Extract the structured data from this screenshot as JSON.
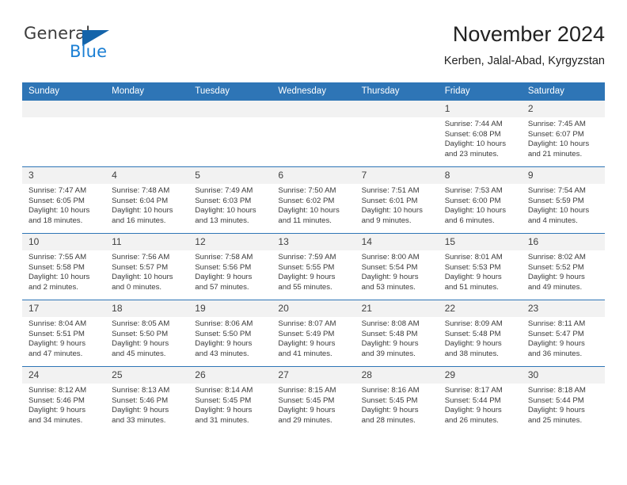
{
  "brand": {
    "word_one": "General",
    "word_two": "Blue",
    "triangle_color": "#1464aa",
    "blue_color": "#1b7fd4",
    "gray_color": "#3c3c3c"
  },
  "header": {
    "title": "November 2024",
    "subtitle": "Kerben, Jalal-Abad, Kyrgyzstan"
  },
  "theme": {
    "header_blue": "#2e75b6",
    "daynum_band": "#f2f2f2",
    "text": "#3a3a3a"
  },
  "weekday_headers": [
    "Sunday",
    "Monday",
    "Tuesday",
    "Wednesday",
    "Thursday",
    "Friday",
    "Saturday"
  ],
  "labels": {
    "sunrise_prefix": "Sunrise:",
    "sunset_prefix": "Sunset:",
    "daylight_prefix": "Daylight:"
  },
  "weeks": [
    [
      {
        "day": "",
        "sunrise": "",
        "sunset": "",
        "daylight_line1": "",
        "daylight_line2": ""
      },
      {
        "day": "",
        "sunrise": "",
        "sunset": "",
        "daylight_line1": "",
        "daylight_line2": ""
      },
      {
        "day": "",
        "sunrise": "",
        "sunset": "",
        "daylight_line1": "",
        "daylight_line2": ""
      },
      {
        "day": "",
        "sunrise": "",
        "sunset": "",
        "daylight_line1": "",
        "daylight_line2": ""
      },
      {
        "day": "",
        "sunrise": "",
        "sunset": "",
        "daylight_line1": "",
        "daylight_line2": ""
      },
      {
        "day": "1",
        "sunrise": "Sunrise: 7:44 AM",
        "sunset": "Sunset: 6:08 PM",
        "daylight_line1": "Daylight: 10 hours",
        "daylight_line2": "and 23 minutes."
      },
      {
        "day": "2",
        "sunrise": "Sunrise: 7:45 AM",
        "sunset": "Sunset: 6:07 PM",
        "daylight_line1": "Daylight: 10 hours",
        "daylight_line2": "and 21 minutes."
      }
    ],
    [
      {
        "day": "3",
        "sunrise": "Sunrise: 7:47 AM",
        "sunset": "Sunset: 6:05 PM",
        "daylight_line1": "Daylight: 10 hours",
        "daylight_line2": "and 18 minutes."
      },
      {
        "day": "4",
        "sunrise": "Sunrise: 7:48 AM",
        "sunset": "Sunset: 6:04 PM",
        "daylight_line1": "Daylight: 10 hours",
        "daylight_line2": "and 16 minutes."
      },
      {
        "day": "5",
        "sunrise": "Sunrise: 7:49 AM",
        "sunset": "Sunset: 6:03 PM",
        "daylight_line1": "Daylight: 10 hours",
        "daylight_line2": "and 13 minutes."
      },
      {
        "day": "6",
        "sunrise": "Sunrise: 7:50 AM",
        "sunset": "Sunset: 6:02 PM",
        "daylight_line1": "Daylight: 10 hours",
        "daylight_line2": "and 11 minutes."
      },
      {
        "day": "7",
        "sunrise": "Sunrise: 7:51 AM",
        "sunset": "Sunset: 6:01 PM",
        "daylight_line1": "Daylight: 10 hours",
        "daylight_line2": "and 9 minutes."
      },
      {
        "day": "8",
        "sunrise": "Sunrise: 7:53 AM",
        "sunset": "Sunset: 6:00 PM",
        "daylight_line1": "Daylight: 10 hours",
        "daylight_line2": "and 6 minutes."
      },
      {
        "day": "9",
        "sunrise": "Sunrise: 7:54 AM",
        "sunset": "Sunset: 5:59 PM",
        "daylight_line1": "Daylight: 10 hours",
        "daylight_line2": "and 4 minutes."
      }
    ],
    [
      {
        "day": "10",
        "sunrise": "Sunrise: 7:55 AM",
        "sunset": "Sunset: 5:58 PM",
        "daylight_line1": "Daylight: 10 hours",
        "daylight_line2": "and 2 minutes."
      },
      {
        "day": "11",
        "sunrise": "Sunrise: 7:56 AM",
        "sunset": "Sunset: 5:57 PM",
        "daylight_line1": "Daylight: 10 hours",
        "daylight_line2": "and 0 minutes."
      },
      {
        "day": "12",
        "sunrise": "Sunrise: 7:58 AM",
        "sunset": "Sunset: 5:56 PM",
        "daylight_line1": "Daylight: 9 hours",
        "daylight_line2": "and 57 minutes."
      },
      {
        "day": "13",
        "sunrise": "Sunrise: 7:59 AM",
        "sunset": "Sunset: 5:55 PM",
        "daylight_line1": "Daylight: 9 hours",
        "daylight_line2": "and 55 minutes."
      },
      {
        "day": "14",
        "sunrise": "Sunrise: 8:00 AM",
        "sunset": "Sunset: 5:54 PM",
        "daylight_line1": "Daylight: 9 hours",
        "daylight_line2": "and 53 minutes."
      },
      {
        "day": "15",
        "sunrise": "Sunrise: 8:01 AM",
        "sunset": "Sunset: 5:53 PM",
        "daylight_line1": "Daylight: 9 hours",
        "daylight_line2": "and 51 minutes."
      },
      {
        "day": "16",
        "sunrise": "Sunrise: 8:02 AM",
        "sunset": "Sunset: 5:52 PM",
        "daylight_line1": "Daylight: 9 hours",
        "daylight_line2": "and 49 minutes."
      }
    ],
    [
      {
        "day": "17",
        "sunrise": "Sunrise: 8:04 AM",
        "sunset": "Sunset: 5:51 PM",
        "daylight_line1": "Daylight: 9 hours",
        "daylight_line2": "and 47 minutes."
      },
      {
        "day": "18",
        "sunrise": "Sunrise: 8:05 AM",
        "sunset": "Sunset: 5:50 PM",
        "daylight_line1": "Daylight: 9 hours",
        "daylight_line2": "and 45 minutes."
      },
      {
        "day": "19",
        "sunrise": "Sunrise: 8:06 AM",
        "sunset": "Sunset: 5:50 PM",
        "daylight_line1": "Daylight: 9 hours",
        "daylight_line2": "and 43 minutes."
      },
      {
        "day": "20",
        "sunrise": "Sunrise: 8:07 AM",
        "sunset": "Sunset: 5:49 PM",
        "daylight_line1": "Daylight: 9 hours",
        "daylight_line2": "and 41 minutes."
      },
      {
        "day": "21",
        "sunrise": "Sunrise: 8:08 AM",
        "sunset": "Sunset: 5:48 PM",
        "daylight_line1": "Daylight: 9 hours",
        "daylight_line2": "and 39 minutes."
      },
      {
        "day": "22",
        "sunrise": "Sunrise: 8:09 AM",
        "sunset": "Sunset: 5:48 PM",
        "daylight_line1": "Daylight: 9 hours",
        "daylight_line2": "and 38 minutes."
      },
      {
        "day": "23",
        "sunrise": "Sunrise: 8:11 AM",
        "sunset": "Sunset: 5:47 PM",
        "daylight_line1": "Daylight: 9 hours",
        "daylight_line2": "and 36 minutes."
      }
    ],
    [
      {
        "day": "24",
        "sunrise": "Sunrise: 8:12 AM",
        "sunset": "Sunset: 5:46 PM",
        "daylight_line1": "Daylight: 9 hours",
        "daylight_line2": "and 34 minutes."
      },
      {
        "day": "25",
        "sunrise": "Sunrise: 8:13 AM",
        "sunset": "Sunset: 5:46 PM",
        "daylight_line1": "Daylight: 9 hours",
        "daylight_line2": "and 33 minutes."
      },
      {
        "day": "26",
        "sunrise": "Sunrise: 8:14 AM",
        "sunset": "Sunset: 5:45 PM",
        "daylight_line1": "Daylight: 9 hours",
        "daylight_line2": "and 31 minutes."
      },
      {
        "day": "27",
        "sunrise": "Sunrise: 8:15 AM",
        "sunset": "Sunset: 5:45 PM",
        "daylight_line1": "Daylight: 9 hours",
        "daylight_line2": "and 29 minutes."
      },
      {
        "day": "28",
        "sunrise": "Sunrise: 8:16 AM",
        "sunset": "Sunset: 5:45 PM",
        "daylight_line1": "Daylight: 9 hours",
        "daylight_line2": "and 28 minutes."
      },
      {
        "day": "29",
        "sunrise": "Sunrise: 8:17 AM",
        "sunset": "Sunset: 5:44 PM",
        "daylight_line1": "Daylight: 9 hours",
        "daylight_line2": "and 26 minutes."
      },
      {
        "day": "30",
        "sunrise": "Sunrise: 8:18 AM",
        "sunset": "Sunset: 5:44 PM",
        "daylight_line1": "Daylight: 9 hours",
        "daylight_line2": "and 25 minutes."
      }
    ]
  ]
}
